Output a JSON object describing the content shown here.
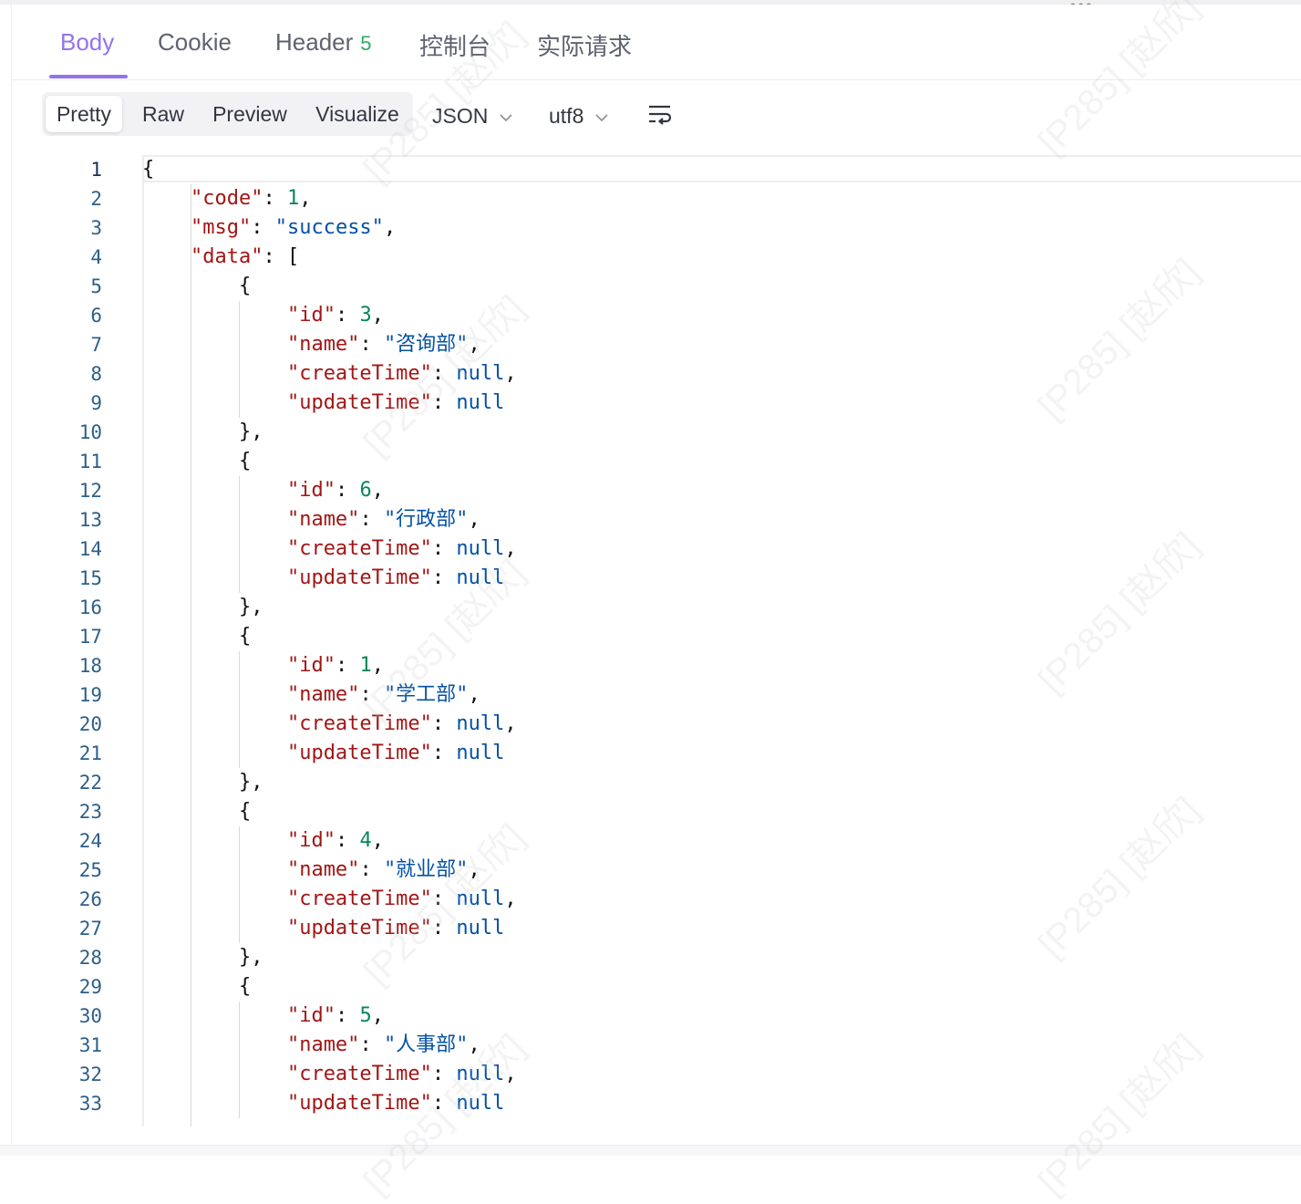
{
  "tabs": [
    {
      "label": "Body",
      "active": true
    },
    {
      "label": "Cookie",
      "active": false
    },
    {
      "label": "Header",
      "badge": "5",
      "active": false
    },
    {
      "label": "控制台",
      "active": false
    },
    {
      "label": "实际请求",
      "active": false
    }
  ],
  "view_modes": [
    "Pretty",
    "Raw",
    "Preview",
    "Visualize"
  ],
  "active_view_mode": "Pretty",
  "format_select": "JSON",
  "encoding_select": "utf8",
  "icons": {
    "wrap": "wrap-lines-icon",
    "more": "more-dots-icon",
    "chevron": "chevron-down-icon"
  },
  "colors": {
    "accent": "#9373ee",
    "badge": "#2eaa66",
    "key": "#a31515",
    "string": "#0451a5",
    "number": "#098658"
  },
  "watermark": "[P285] [赵欣]",
  "code_lines": [
    [
      {
        "t": "p",
        "v": "{"
      }
    ],
    [
      {
        "t": "p",
        "v": "    "
      },
      {
        "t": "k",
        "v": "\"code\""
      },
      {
        "t": "p",
        "v": ": "
      },
      {
        "t": "n",
        "v": "1"
      },
      {
        "t": "p",
        "v": ","
      }
    ],
    [
      {
        "t": "p",
        "v": "    "
      },
      {
        "t": "k",
        "v": "\"msg\""
      },
      {
        "t": "p",
        "v": ": "
      },
      {
        "t": "s",
        "v": "\"success\""
      },
      {
        "t": "p",
        "v": ","
      }
    ],
    [
      {
        "t": "p",
        "v": "    "
      },
      {
        "t": "k",
        "v": "\"data\""
      },
      {
        "t": "p",
        "v": ": ["
      }
    ],
    [
      {
        "t": "p",
        "v": "        {"
      }
    ],
    [
      {
        "t": "p",
        "v": "            "
      },
      {
        "t": "k",
        "v": "\"id\""
      },
      {
        "t": "p",
        "v": ": "
      },
      {
        "t": "n",
        "v": "3"
      },
      {
        "t": "p",
        "v": ","
      }
    ],
    [
      {
        "t": "p",
        "v": "            "
      },
      {
        "t": "k",
        "v": "\"name\""
      },
      {
        "t": "p",
        "v": ": "
      },
      {
        "t": "s",
        "v": "\"咨询部\""
      },
      {
        "t": "p",
        "v": ","
      }
    ],
    [
      {
        "t": "p",
        "v": "            "
      },
      {
        "t": "k",
        "v": "\"createTime\""
      },
      {
        "t": "p",
        "v": ": "
      },
      {
        "t": "nl",
        "v": "null"
      },
      {
        "t": "p",
        "v": ","
      }
    ],
    [
      {
        "t": "p",
        "v": "            "
      },
      {
        "t": "k",
        "v": "\"updateTime\""
      },
      {
        "t": "p",
        "v": ": "
      },
      {
        "t": "nl",
        "v": "null"
      }
    ],
    [
      {
        "t": "p",
        "v": "        },"
      }
    ],
    [
      {
        "t": "p",
        "v": "        {"
      }
    ],
    [
      {
        "t": "p",
        "v": "            "
      },
      {
        "t": "k",
        "v": "\"id\""
      },
      {
        "t": "p",
        "v": ": "
      },
      {
        "t": "n",
        "v": "6"
      },
      {
        "t": "p",
        "v": ","
      }
    ],
    [
      {
        "t": "p",
        "v": "            "
      },
      {
        "t": "k",
        "v": "\"name\""
      },
      {
        "t": "p",
        "v": ": "
      },
      {
        "t": "s",
        "v": "\"行政部\""
      },
      {
        "t": "p",
        "v": ","
      }
    ],
    [
      {
        "t": "p",
        "v": "            "
      },
      {
        "t": "k",
        "v": "\"createTime\""
      },
      {
        "t": "p",
        "v": ": "
      },
      {
        "t": "nl",
        "v": "null"
      },
      {
        "t": "p",
        "v": ","
      }
    ],
    [
      {
        "t": "p",
        "v": "            "
      },
      {
        "t": "k",
        "v": "\"updateTime\""
      },
      {
        "t": "p",
        "v": ": "
      },
      {
        "t": "nl",
        "v": "null"
      }
    ],
    [
      {
        "t": "p",
        "v": "        },"
      }
    ],
    [
      {
        "t": "p",
        "v": "        {"
      }
    ],
    [
      {
        "t": "p",
        "v": "            "
      },
      {
        "t": "k",
        "v": "\"id\""
      },
      {
        "t": "p",
        "v": ": "
      },
      {
        "t": "n",
        "v": "1"
      },
      {
        "t": "p",
        "v": ","
      }
    ],
    [
      {
        "t": "p",
        "v": "            "
      },
      {
        "t": "k",
        "v": "\"name\""
      },
      {
        "t": "p",
        "v": ": "
      },
      {
        "t": "s",
        "v": "\"学工部\""
      },
      {
        "t": "p",
        "v": ","
      }
    ],
    [
      {
        "t": "p",
        "v": "            "
      },
      {
        "t": "k",
        "v": "\"createTime\""
      },
      {
        "t": "p",
        "v": ": "
      },
      {
        "t": "nl",
        "v": "null"
      },
      {
        "t": "p",
        "v": ","
      }
    ],
    [
      {
        "t": "p",
        "v": "            "
      },
      {
        "t": "k",
        "v": "\"updateTime\""
      },
      {
        "t": "p",
        "v": ": "
      },
      {
        "t": "nl",
        "v": "null"
      }
    ],
    [
      {
        "t": "p",
        "v": "        },"
      }
    ],
    [
      {
        "t": "p",
        "v": "        {"
      }
    ],
    [
      {
        "t": "p",
        "v": "            "
      },
      {
        "t": "k",
        "v": "\"id\""
      },
      {
        "t": "p",
        "v": ": "
      },
      {
        "t": "n",
        "v": "4"
      },
      {
        "t": "p",
        "v": ","
      }
    ],
    [
      {
        "t": "p",
        "v": "            "
      },
      {
        "t": "k",
        "v": "\"name\""
      },
      {
        "t": "p",
        "v": ": "
      },
      {
        "t": "s",
        "v": "\"就业部\""
      },
      {
        "t": "p",
        "v": ","
      }
    ],
    [
      {
        "t": "p",
        "v": "            "
      },
      {
        "t": "k",
        "v": "\"createTime\""
      },
      {
        "t": "p",
        "v": ": "
      },
      {
        "t": "nl",
        "v": "null"
      },
      {
        "t": "p",
        "v": ","
      }
    ],
    [
      {
        "t": "p",
        "v": "            "
      },
      {
        "t": "k",
        "v": "\"updateTime\""
      },
      {
        "t": "p",
        "v": ": "
      },
      {
        "t": "nl",
        "v": "null"
      }
    ],
    [
      {
        "t": "p",
        "v": "        },"
      }
    ],
    [
      {
        "t": "p",
        "v": "        {"
      }
    ],
    [
      {
        "t": "p",
        "v": "            "
      },
      {
        "t": "k",
        "v": "\"id\""
      },
      {
        "t": "p",
        "v": ": "
      },
      {
        "t": "n",
        "v": "5"
      },
      {
        "t": "p",
        "v": ","
      }
    ],
    [
      {
        "t": "p",
        "v": "            "
      },
      {
        "t": "k",
        "v": "\"name\""
      },
      {
        "t": "p",
        "v": ": "
      },
      {
        "t": "s",
        "v": "\"人事部\""
      },
      {
        "t": "p",
        "v": ","
      }
    ],
    [
      {
        "t": "p",
        "v": "            "
      },
      {
        "t": "k",
        "v": "\"createTime\""
      },
      {
        "t": "p",
        "v": ": "
      },
      {
        "t": "nl",
        "v": "null"
      },
      {
        "t": "p",
        "v": ","
      }
    ],
    [
      {
        "t": "p",
        "v": "            "
      },
      {
        "t": "k",
        "v": "\"updateTime\""
      },
      {
        "t": "p",
        "v": ": "
      },
      {
        "t": "nl",
        "v": "null"
      }
    ]
  ]
}
